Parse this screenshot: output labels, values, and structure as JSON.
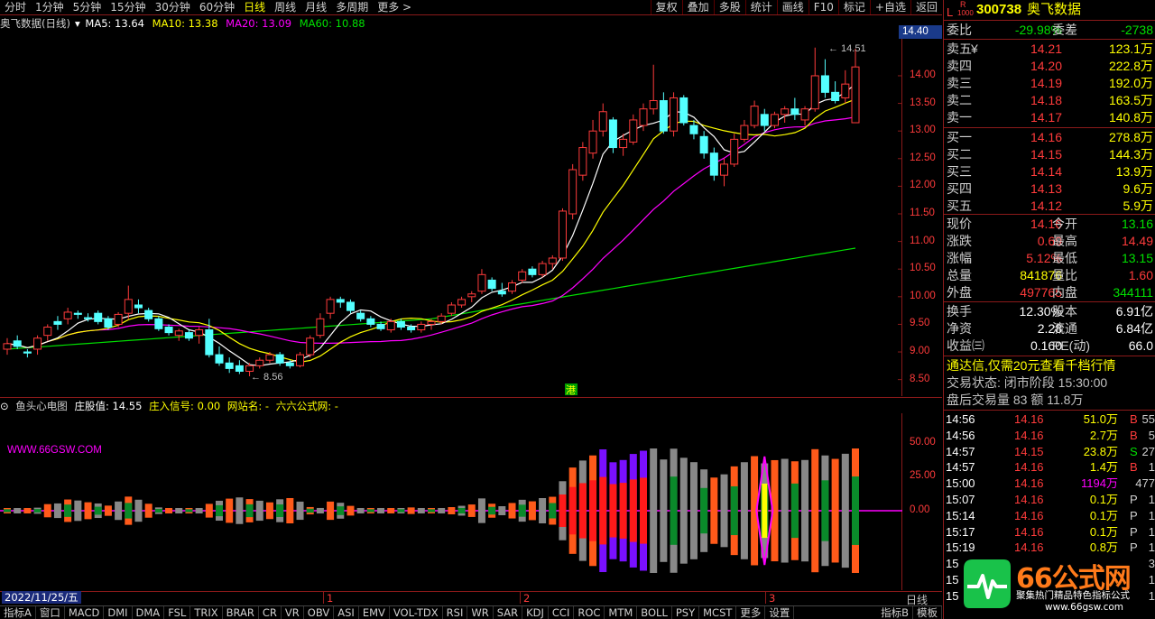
{
  "toolbar": {
    "periods": [
      "分时",
      "1分钟",
      "5分钟",
      "15分钟",
      "30分钟",
      "60分钟",
      "日线",
      "周线",
      "月线",
      "多周期",
      "更多 >"
    ],
    "active_period": "日线",
    "right_buttons": [
      "复权",
      "叠加",
      "多股",
      "统计",
      "画线",
      "F10",
      "标记",
      "+自选",
      "返回"
    ]
  },
  "chart_header": {
    "stock": "奥飞数据(日线)",
    "ma5": "MA5: 13.64",
    "ma10": "MA10: 13.38",
    "ma20": "MA20: 13.09",
    "ma60": "MA60: 10.88"
  },
  "price_axis": {
    "labels": [
      "14.00",
      "13.50",
      "13.00",
      "12.50",
      "12.00",
      "11.50",
      "11.00",
      "10.50",
      "10.00",
      "9.50",
      "9.00",
      "8.50"
    ],
    "current": "14.40"
  },
  "annotations": {
    "high": "14.51",
    "low": "8.56",
    "hk": "港"
  },
  "indicator_header": {
    "name": "鱼头心电图",
    "zhuang": "庄股值: 14.55",
    "signal": "庄入信号: 0.00",
    "site": "网站名: -",
    "site2": "六六公式网: -"
  },
  "watermark": "WWW.66GSW.COM",
  "indicator_axis": {
    "labels": [
      "50.00",
      "25.00",
      "0.00"
    ]
  },
  "timeline": {
    "date": "2022/11/25/五",
    "month1": "1",
    "month2": "2",
    "month3": "3",
    "mode": "日线"
  },
  "tabs": [
    "指标A",
    "窗口",
    "MACD",
    "DMI",
    "DMA",
    "FSL",
    "TRIX",
    "BRAR",
    "CR",
    "VR",
    "OBV",
    "ASI",
    "EMV",
    "VOL-TDX",
    "RSI",
    "WR",
    "SAR",
    "KDJ",
    "CCI",
    "ROC",
    "MTM",
    "BOLL",
    "PSY",
    "MCST",
    "更多",
    "设置",
    "指标B",
    "模板"
  ],
  "quote": {
    "badge_l": "L",
    "badge_r": "R",
    "badge_num": "1000",
    "code": "300738",
    "name": "奥飞数据",
    "weibi_label": "委比",
    "weibi": "-29.98%",
    "weicha_label": "委差",
    "weicha": "-2738",
    "asks": [
      {
        "label": "卖五",
        "mark": "¥",
        "price": "14.21",
        "vol": "123.1万"
      },
      {
        "label": "卖四",
        "mark": "",
        "price": "14.20",
        "vol": "222.8万"
      },
      {
        "label": "卖三",
        "mark": "",
        "price": "14.19",
        "vol": "192.0万"
      },
      {
        "label": "卖二",
        "mark": "",
        "price": "14.18",
        "vol": "163.5万"
      },
      {
        "label": "卖一",
        "mark": "",
        "price": "14.17",
        "vol": "140.8万"
      }
    ],
    "bids": [
      {
        "label": "买一",
        "price": "14.16",
        "vol": "278.8万"
      },
      {
        "label": "买二",
        "price": "14.15",
        "vol": "144.3万"
      },
      {
        "label": "买三",
        "price": "14.14",
        "vol": "13.9万"
      },
      {
        "label": "买四",
        "price": "14.13",
        "vol": "9.6万"
      },
      {
        "label": "买五",
        "price": "14.12",
        "vol": "5.9万"
      }
    ],
    "stats": [
      {
        "l1": "现价",
        "v1": "14.16",
        "l2": "今开",
        "v2": "13.16",
        "c1": "red",
        "c2": "green"
      },
      {
        "l1": "涨跌",
        "v1": "0.69",
        "l2": "最高",
        "v2": "14.49",
        "c1": "red",
        "c2": "red"
      },
      {
        "l1": "涨幅",
        "v1": "5.12%",
        "l2": "最低",
        "v2": "13.15",
        "c1": "red",
        "c2": "green"
      },
      {
        "l1": "总量",
        "v1": "841876",
        "l2": "量比",
        "v2": "1.60",
        "c1": "yellow",
        "c2": "red"
      },
      {
        "l1": "外盘",
        "v1": "497765",
        "l2": "内盘",
        "v2": "344111",
        "c1": "red",
        "c2": "green"
      }
    ],
    "stats2": [
      {
        "l1": "换手",
        "v1": "12.30%",
        "l2": "股本",
        "v2": "6.91亿"
      },
      {
        "l1": "净资",
        "v1": "2.28",
        "l2": "流通",
        "v2": "6.84亿"
      },
      {
        "l1": "收益㈢",
        "v1": "0.160",
        "l2": "PE(动)",
        "v2": "66.0"
      }
    ],
    "ad": "通达信,仅需20元查看千档行情",
    "trade_status": "交易状态: 闭市阶段 15:30:00",
    "after_hours": "盘后交易量 83 额 11.8万",
    "ticks": [
      {
        "time": "14:56",
        "price": "14.16",
        "vol": "51.0万",
        "bs": "B",
        "n": "55"
      },
      {
        "time": "14:56",
        "price": "14.16",
        "vol": "2.7万",
        "bs": "B",
        "n": "5"
      },
      {
        "time": "14:57",
        "price": "14.15",
        "vol": "23.8万",
        "bs": "S",
        "n": "27"
      },
      {
        "time": "14:57",
        "price": "14.16",
        "vol": "1.4万",
        "bs": "B",
        "n": "1"
      },
      {
        "time": "15:00",
        "price": "14.16",
        "vol": "1194万",
        "bs": "",
        "n": "477"
      },
      {
        "time": "15:07",
        "price": "14.16",
        "vol": "0.1万",
        "bs": "P",
        "n": "1"
      },
      {
        "time": "15:14",
        "price": "14.16",
        "vol": "0.1万",
        "bs": "P",
        "n": "1"
      },
      {
        "time": "15:17",
        "price": "14.16",
        "vol": "0.1万",
        "bs": "P",
        "n": "1"
      },
      {
        "time": "15:19",
        "price": "14.16",
        "vol": "0.8万",
        "bs": "P",
        "n": "1"
      },
      {
        "time": "15",
        "price": "",
        "vol": "",
        "bs": "",
        "n": "3"
      },
      {
        "time": "15",
        "price": "",
        "vol": "",
        "bs": "",
        "n": "1"
      },
      {
        "time": "15",
        "price": "",
        "vol": "",
        "bs": "",
        "n": "1"
      }
    ]
  },
  "logo": {
    "text": "66公式网",
    "sub": "聚集热门精品特色指标公式",
    "url": "www.66gsw.com"
  },
  "colors": {
    "up": "#ff3b3b",
    "down": "#54ffff",
    "ma5": "#ffffff",
    "ma10": "#ffff00",
    "ma20": "#ff00ff",
    "ma60": "#00e000",
    "frame": "#8b1a1a"
  },
  "chart_data": {
    "type": "candlestick",
    "ylim": [
      8.2,
      14.8
    ],
    "candles": [
      [
        9.05,
        9.25,
        8.95,
        9.15
      ],
      [
        9.2,
        9.3,
        9.05,
        9.1
      ],
      [
        9.0,
        9.05,
        8.9,
        8.98
      ],
      [
        9.05,
        9.3,
        8.95,
        9.25
      ],
      [
        9.3,
        9.5,
        9.2,
        9.45
      ],
      [
        9.55,
        9.65,
        9.4,
        9.5
      ],
      [
        9.6,
        9.8,
        9.5,
        9.72
      ],
      [
        9.7,
        9.75,
        9.6,
        9.68
      ],
      [
        9.62,
        9.7,
        9.55,
        9.6
      ],
      [
        9.7,
        9.75,
        9.5,
        9.55
      ],
      [
        9.6,
        9.65,
        9.4,
        9.45
      ],
      [
        9.5,
        9.72,
        9.45,
        9.68
      ],
      [
        9.7,
        10.2,
        9.6,
        9.95
      ],
      [
        9.85,
        9.95,
        9.7,
        9.8
      ],
      [
        9.75,
        9.8,
        9.55,
        9.6
      ],
      [
        9.6,
        9.65,
        9.38,
        9.42
      ],
      [
        9.45,
        9.5,
        9.3,
        9.35
      ],
      [
        9.3,
        9.42,
        9.2,
        9.38
      ],
      [
        9.35,
        9.4,
        9.2,
        9.25
      ],
      [
        9.3,
        9.45,
        9.15,
        9.4
      ],
      [
        9.4,
        9.6,
        8.9,
        8.95
      ],
      [
        8.95,
        9.1,
        8.75,
        8.8
      ],
      [
        8.8,
        8.9,
        8.62,
        8.7
      ],
      [
        8.75,
        8.85,
        8.6,
        8.65
      ],
      [
        8.65,
        8.8,
        8.56,
        8.75
      ],
      [
        8.75,
        8.9,
        8.7,
        8.85
      ],
      [
        8.85,
        9.0,
        8.8,
        8.95
      ],
      [
        8.95,
        9.0,
        8.75,
        8.8
      ],
      [
        8.8,
        8.85,
        8.7,
        8.75
      ],
      [
        8.75,
        9.0,
        8.72,
        8.95
      ],
      [
        8.95,
        9.3,
        8.9,
        9.25
      ],
      [
        9.3,
        9.7,
        9.25,
        9.6
      ],
      [
        9.7,
        10.0,
        9.6,
        9.95
      ],
      [
        9.95,
        10.0,
        9.8,
        9.9
      ],
      [
        9.9,
        9.95,
        9.7,
        9.75
      ],
      [
        9.7,
        9.75,
        9.55,
        9.6
      ],
      [
        9.6,
        9.65,
        9.45,
        9.5
      ],
      [
        9.5,
        9.55,
        9.38,
        9.42
      ],
      [
        9.4,
        9.6,
        9.35,
        9.55
      ],
      [
        9.55,
        9.6,
        9.4,
        9.45
      ],
      [
        9.45,
        9.5,
        9.35,
        9.4
      ],
      [
        9.4,
        9.55,
        9.35,
        9.5
      ],
      [
        9.5,
        9.6,
        9.4,
        9.55
      ],
      [
        9.55,
        9.7,
        9.5,
        9.65
      ],
      [
        9.7,
        9.9,
        9.65,
        9.85
      ],
      [
        9.85,
        10.0,
        9.8,
        9.95
      ],
      [
        10.0,
        10.1,
        9.9,
        10.05
      ],
      [
        10.1,
        10.5,
        10.05,
        10.4
      ],
      [
        10.3,
        10.35,
        10.1,
        10.15
      ],
      [
        10.1,
        10.25,
        10.0,
        10.05
      ],
      [
        10.1,
        10.3,
        10.05,
        10.25
      ],
      [
        10.3,
        10.5,
        10.25,
        10.45
      ],
      [
        10.5,
        10.55,
        10.35,
        10.4
      ],
      [
        10.4,
        10.65,
        10.35,
        10.6
      ],
      [
        10.6,
        10.75,
        10.5,
        10.7
      ],
      [
        10.7,
        11.6,
        10.65,
        11.55
      ],
      [
        11.5,
        12.4,
        11.4,
        12.3
      ],
      [
        12.2,
        12.8,
        12.1,
        12.7
      ],
      [
        12.6,
        13.2,
        12.5,
        13.0
      ],
      [
        13.0,
        13.5,
        12.9,
        13.35
      ],
      [
        13.2,
        13.25,
        12.6,
        12.7
      ],
      [
        12.7,
        12.95,
        12.55,
        12.85
      ],
      [
        12.8,
        13.3,
        12.75,
        13.2
      ],
      [
        13.1,
        13.5,
        13.0,
        13.4
      ],
      [
        13.4,
        14.2,
        13.3,
        13.55
      ],
      [
        13.55,
        13.7,
        12.95,
        13.0
      ],
      [
        13.0,
        13.7,
        12.9,
        13.6
      ],
      [
        13.6,
        13.65,
        13.1,
        13.15
      ],
      [
        13.1,
        13.2,
        12.85,
        12.95
      ],
      [
        12.9,
        13.0,
        12.5,
        12.6
      ],
      [
        12.6,
        12.7,
        12.1,
        12.2
      ],
      [
        12.2,
        12.5,
        12.0,
        12.4
      ],
      [
        12.4,
        12.95,
        12.35,
        12.85
      ],
      [
        12.85,
        13.2,
        12.8,
        13.1
      ],
      [
        13.1,
        13.55,
        13.05,
        13.45
      ],
      [
        13.3,
        13.4,
        13.0,
        13.1
      ],
      [
        13.1,
        13.35,
        13.05,
        13.3
      ],
      [
        13.3,
        13.45,
        13.15,
        13.4
      ],
      [
        13.4,
        13.6,
        13.2,
        13.3
      ],
      [
        13.2,
        13.45,
        13.1,
        13.4
      ],
      [
        13.4,
        14.51,
        13.35,
        14.0
      ],
      [
        14.0,
        14.3,
        13.6,
        13.7
      ],
      [
        13.7,
        13.9,
        13.5,
        13.55
      ],
      [
        13.6,
        14.1,
        13.5,
        13.85
      ],
      [
        13.15,
        14.49,
        13.15,
        14.16
      ]
    ],
    "ma60_start": 9.05,
    "ma60_end": 10.88,
    "indicator_ylim": [
      -60,
      60
    ]
  }
}
